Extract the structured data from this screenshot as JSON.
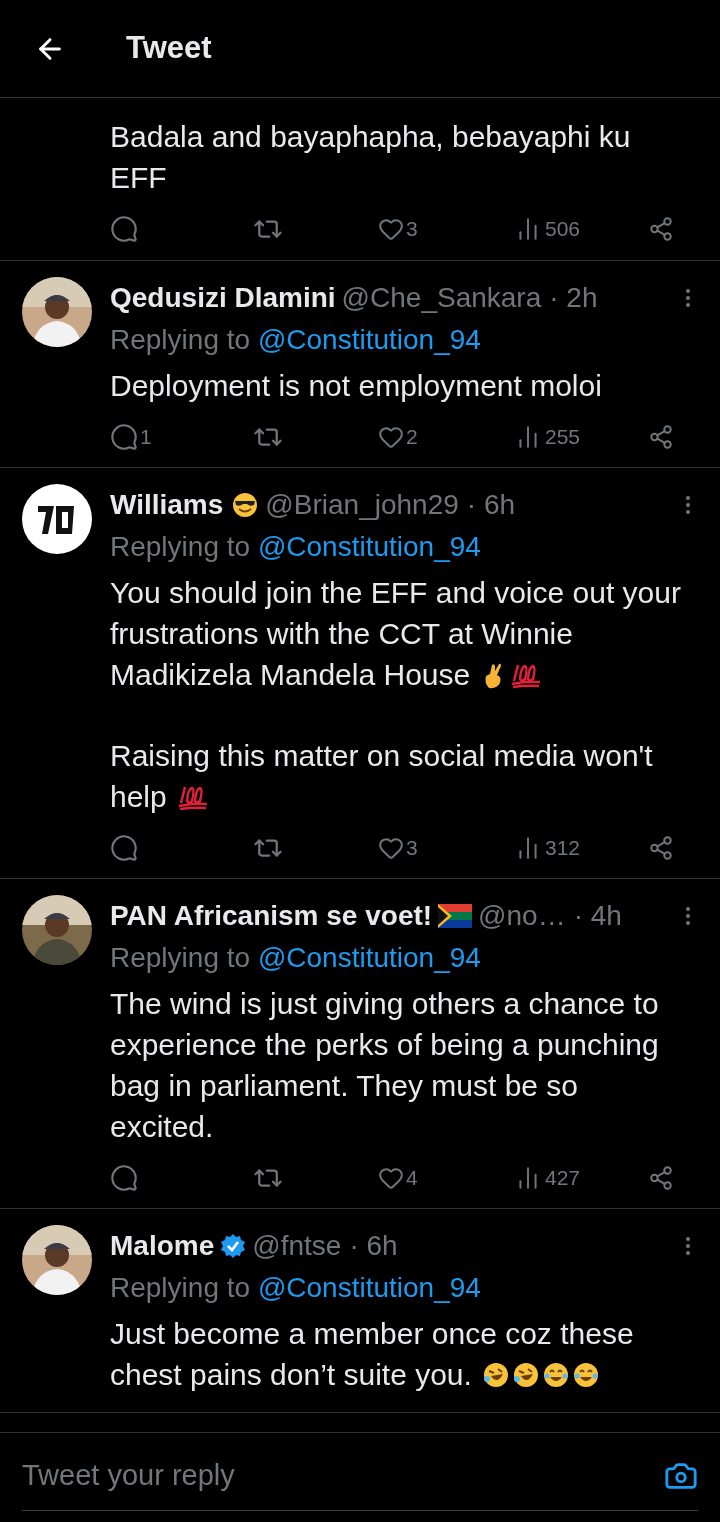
{
  "header": {
    "title": "Tweet"
  },
  "tweets": [
    {
      "paragraphs": [
        {
          "lines": [
            "Badala and bayaphapha, bebayaphi ku",
            "EFF"
          ]
        }
      ],
      "actions": {
        "likes": "3",
        "views": "506"
      }
    },
    {
      "name": "Qedusizi Dlamini",
      "handle": "@Che_Sankara",
      "time": "· 2h",
      "avatar": {
        "kind": "picture"
      },
      "replying_label": "Replying to",
      "replying_to": "@Constitution_94",
      "paragraphs": [
        {
          "lines": [
            "Deployment is not employment moloi"
          ]
        }
      ],
      "actions": {
        "replies": "1",
        "likes": "2",
        "views": "255"
      }
    },
    {
      "name": "Williams",
      "badge": {
        "kind": "sunglasses"
      },
      "handle": "@Brian_john29",
      "time": "· 6h",
      "avatar": {
        "kind": "logo"
      },
      "replying_label": "Replying to",
      "replying_to": "@Constitution_94",
      "paragraphs": [
        {
          "lines": [
            "You should join the EFF and voice out your",
            "frustrations with the CCT at Winnie",
            "Madikizela Mandela House"
          ],
          "icons": [
            {
              "kind": "fingers"
            },
            {
              "kind": "hundred"
            }
          ]
        },
        {
          "lines": [
            "Raising this matter on social media won't",
            "help"
          ],
          "icons": [
            {
              "kind": "hundred"
            }
          ]
        }
      ],
      "actions": {
        "likes": "3",
        "views": "312"
      }
    },
    {
      "name": "PAN Africanism se voet!",
      "badge": {
        "kind": "flag"
      },
      "handle": "@no…",
      "time": "· 4h",
      "avatar": {
        "kind": "picture"
      },
      "replying_label": "Replying to",
      "replying_to": "@Constitution_94",
      "paragraphs": [
        {
          "lines": [
            "The wind is just giving others a chance to",
            "experience the perks of being a punching",
            "bag in parliament. They must be so",
            "excited."
          ]
        }
      ],
      "actions": {
        "likes": "4",
        "views": "427"
      }
    },
    {
      "name": "Malome",
      "badge": {
        "kind": "verified"
      },
      "handle": "@fntse",
      "time": "· 6h",
      "avatar": {
        "kind": "picture"
      },
      "replying_label": "Replying to",
      "replying_to": "@Constitution_94",
      "paragraphs": [
        {
          "lines": [
            "Just become a member once coz these",
            "chest pains don’t suite you."
          ],
          "icons": [
            {
              "kind": "rofl"
            },
            {
              "kind": "rofl"
            },
            {
              "kind": "joy"
            },
            {
              "kind": "joy"
            }
          ]
        }
      ]
    }
  ],
  "reply_bar": {
    "placeholder": "Tweet your reply"
  }
}
